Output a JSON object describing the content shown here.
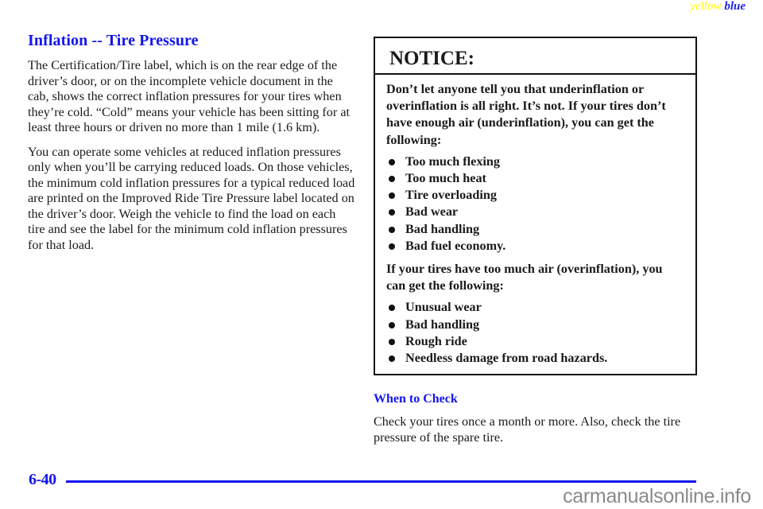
{
  "header": {
    "tag_yellow": "yellow",
    "tag_blue": "blue"
  },
  "left": {
    "title": "Inflation -- Tire Pressure",
    "paragraphs": [
      "The Certification/Tire label, which is on the rear edge of the driver’s door, or on the incomplete vehicle document in the cab, shows the correct inflation pressures for your tires when they’re cold. “Cold” means your vehicle has been sitting for at least three hours or driven no more than 1 mile (1.6 km).",
      "You can operate some vehicles at reduced inflation pressures only when you’ll be carrying reduced loads. On those vehicles, the minimum cold inflation pressures for a typical reduced load are printed on the Improved Ride Tire Pressure label located on the driver’s door. Weigh the vehicle to find the load on each tire and see the label for the minimum cold inflation pressures for that load."
    ]
  },
  "notice": {
    "heading": "NOTICE:",
    "intro": "Don’t let anyone tell you that underinflation or overinflation is all right. It’s not. If your tires don’t have enough air (underinflation), you can get the following:",
    "under_items": [
      "Too much flexing",
      "Too much heat",
      "Tire overloading",
      "Bad wear",
      "Bad handling",
      "Bad fuel economy."
    ],
    "over_intro": "If your tires have too much air (overinflation), you can get the following:",
    "over_items": [
      "Unusual wear",
      "Bad handling",
      "Rough ride",
      "Needless damage from road hazards."
    ]
  },
  "when_to_check": {
    "title": "When to Check",
    "text": "Check your tires once a month or more. Also, check the tire pressure of the spare tire."
  },
  "footer": {
    "page_number": "6-40",
    "watermark": "carmanualsonline.info"
  },
  "colors": {
    "heading_blue": "#1414ee",
    "tag_yellow": "#ffff00",
    "watermark_gray": "#8a8a8a"
  }
}
